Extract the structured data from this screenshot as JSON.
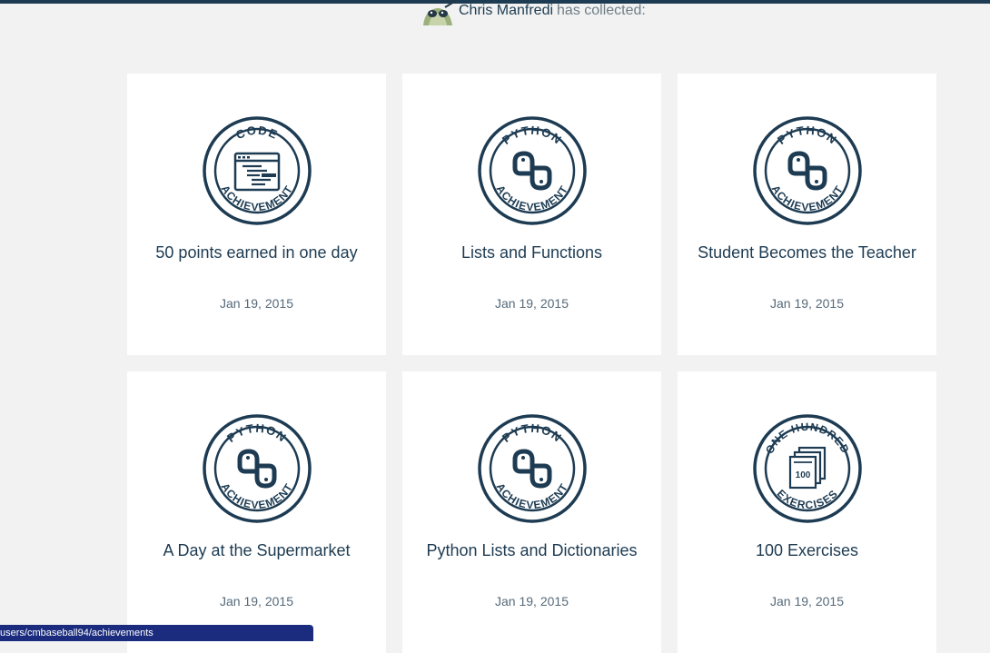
{
  "header": {
    "user_name": "Chris Manfredi",
    "collected_suffix": "has collected:"
  },
  "colors": {
    "navy": "#1d3b52",
    "background": "#f1f2f1",
    "card": "#ffffff",
    "status_bar": "#1b2c7e"
  },
  "achievements": [
    {
      "title": "50 points earned in one day",
      "date": "Jan 19, 2015",
      "badge": {
        "top": "CODE",
        "bottom": "ACHIEVEMENT",
        "icon": "code-window-icon"
      }
    },
    {
      "title": "Lists and Functions",
      "date": "Jan 19, 2015",
      "badge": {
        "top": "PYTHON",
        "bottom": "ACHIEVEMENT",
        "icon": "python-logo-icon"
      }
    },
    {
      "title": "Student Becomes the Teacher",
      "date": "Jan 19, 2015",
      "badge": {
        "top": "PYTHON",
        "bottom": "ACHIEVEMENT",
        "icon": "python-logo-icon"
      }
    },
    {
      "title": "A Day at the Supermarket",
      "date": "Jan 19, 2015",
      "badge": {
        "top": "PYTHON",
        "bottom": "ACHIEVEMENT",
        "icon": "python-logo-icon"
      }
    },
    {
      "title": "Python Lists and Dictionaries",
      "date": "Jan 19, 2015",
      "badge": {
        "top": "PYTHON",
        "bottom": "ACHIEVEMENT",
        "icon": "python-logo-icon"
      }
    },
    {
      "title": "100 Exercises",
      "date": "Jan 19, 2015",
      "badge": {
        "top": "ONE HUNDRED",
        "bottom": "EXERCISES",
        "icon": "stacked-pages-100-icon",
        "inner_label": "100"
      }
    }
  ],
  "status_bar": {
    "url": "users/cmbaseball94/achievements"
  }
}
